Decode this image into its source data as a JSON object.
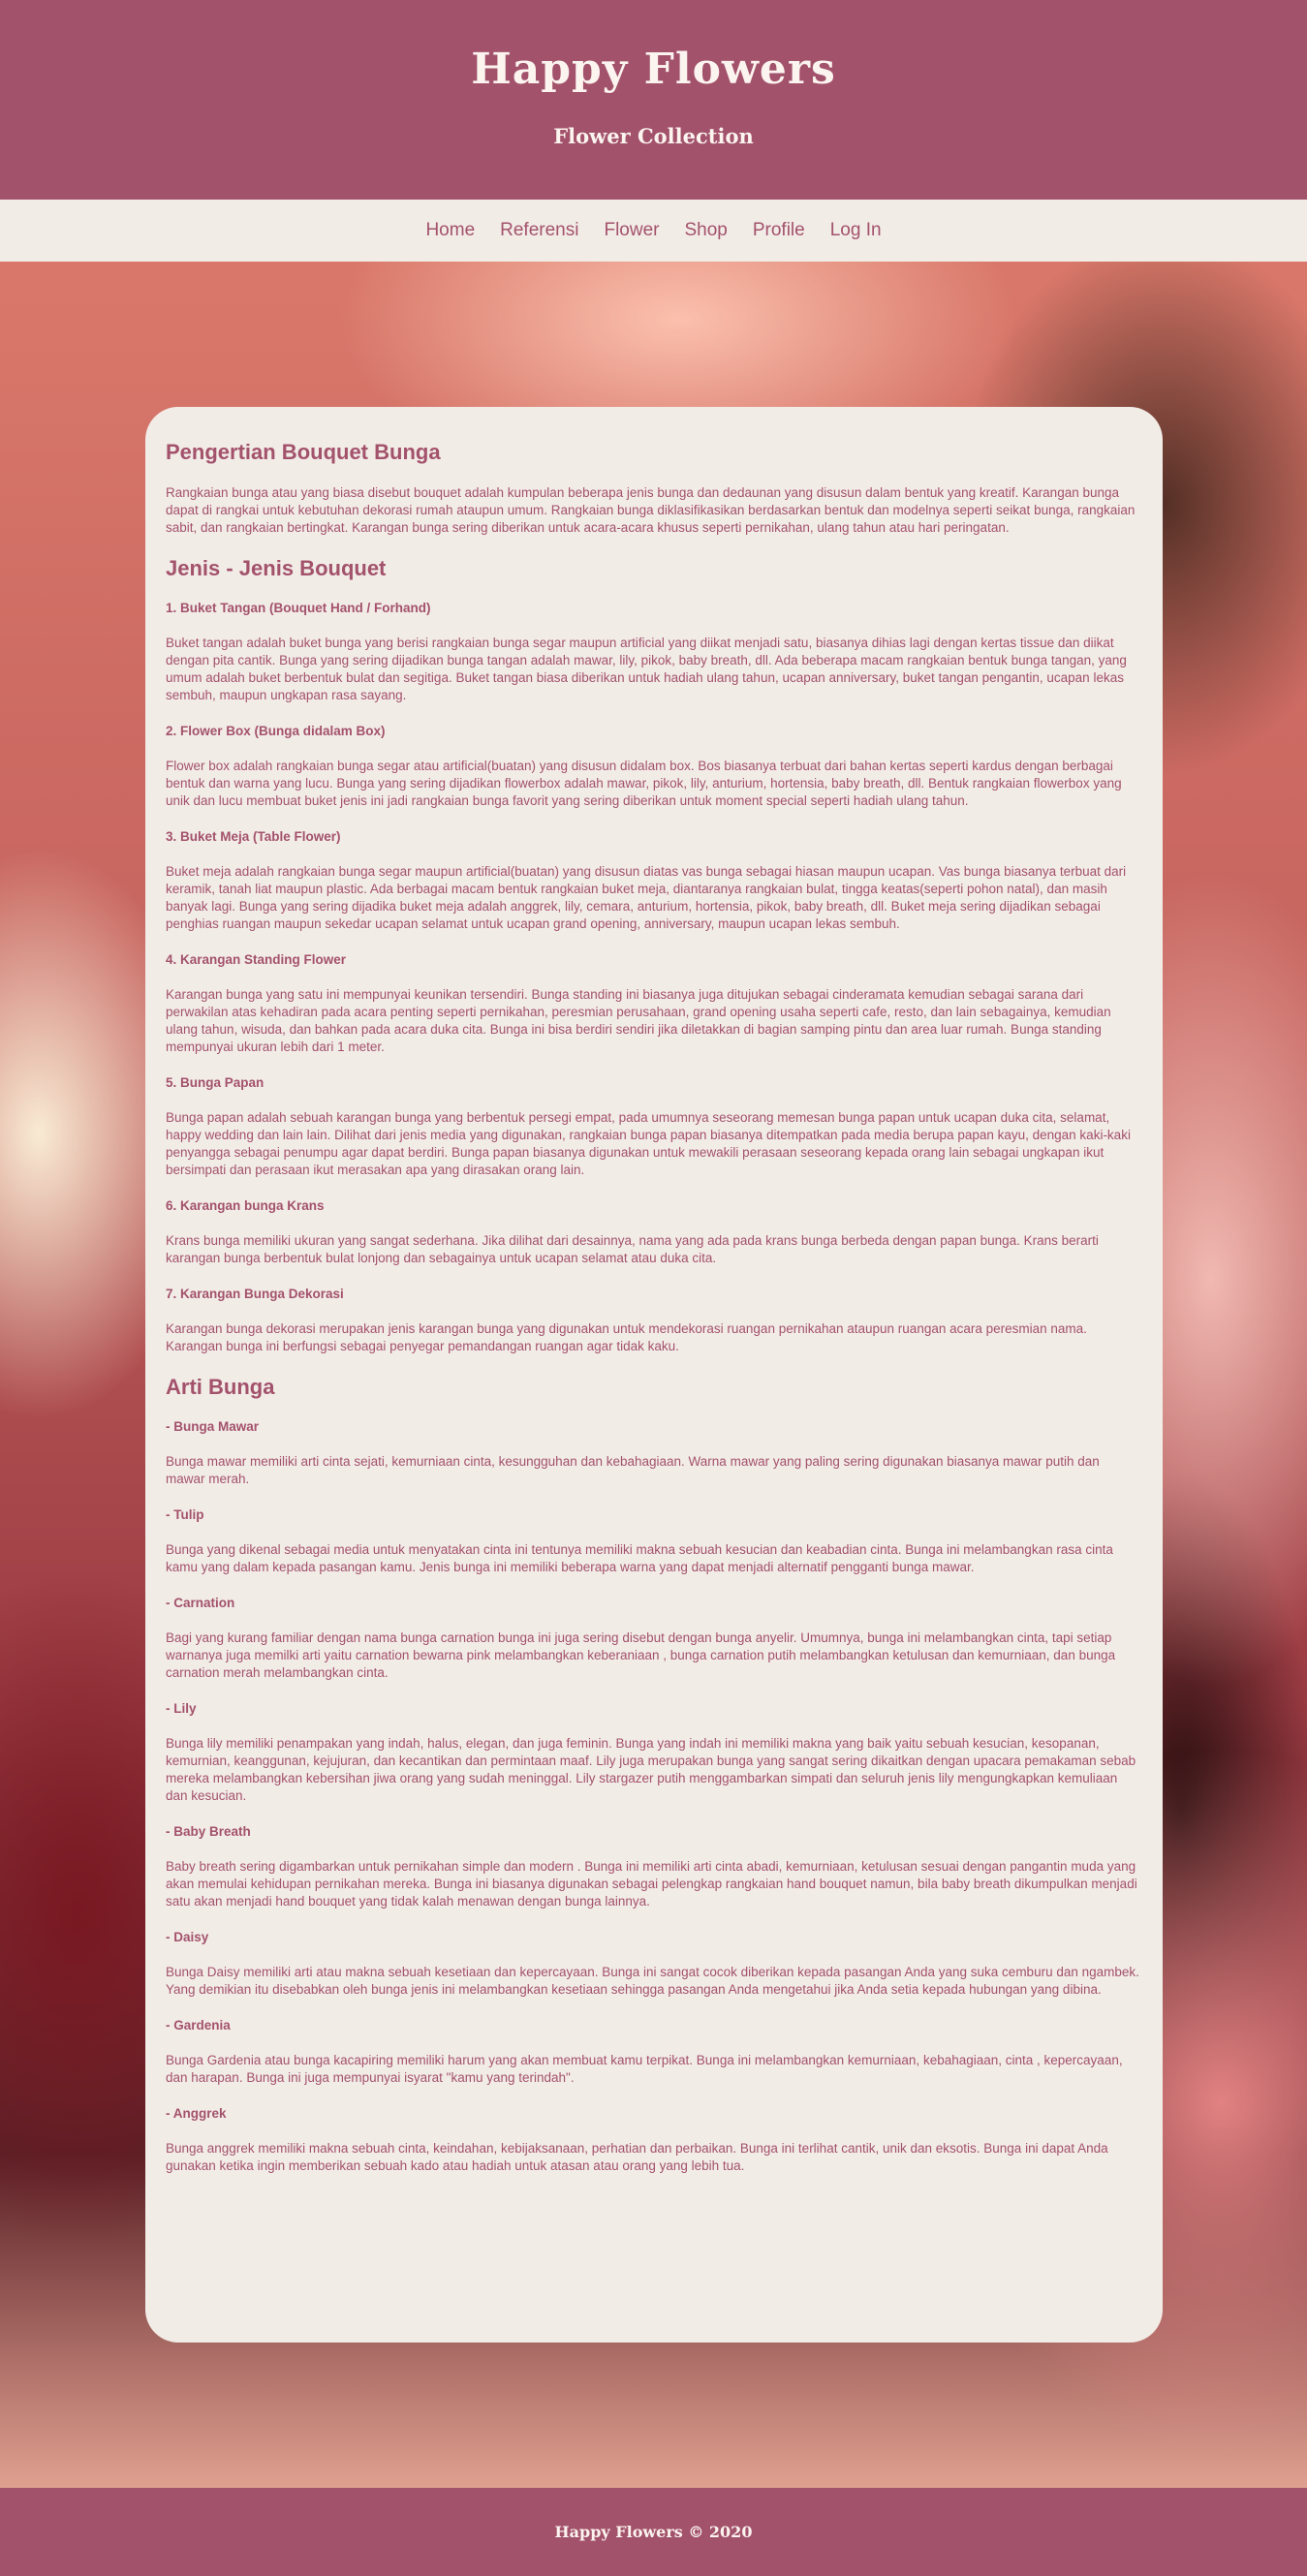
{
  "header": {
    "title": "Happy Flowers",
    "subtitle": "Flower Collection"
  },
  "nav": {
    "items": [
      "Home",
      "Referensi",
      "Flower",
      "Shop",
      "Profile",
      "Log In"
    ]
  },
  "content": {
    "s1_title": "Pengertian Bouquet Bunga",
    "s1_text": "Rangkaian bunga atau yang biasa disebut bouquet adalah kumpulan beberapa jenis bunga dan dedaunan yang disusun dalam bentuk yang kreatif. Karangan bunga dapat di rangkai untuk kebutuhan dekorasi rumah ataupun umum. Rangkaian bunga diklasifikasikan berdasarkan bentuk dan modelnya seperti seikat bunga, rangkaian sabit, dan rangkaian bertingkat. Karangan bunga sering diberikan untuk acara-acara khusus seperti pernikahan, ulang tahun atau hari peringatan.",
    "s2_title": "Jenis - Jenis Bouquet",
    "types": [
      {
        "title": "1. Buket Tangan (Bouquet Hand / Forhand)",
        "text": "Buket tangan adalah buket bunga yang berisi rangkaian bunga segar maupun artificial yang diikat menjadi satu, biasanya dihias lagi dengan kertas tissue dan diikat dengan pita cantik. Bunga yang sering dijadikan bunga tangan adalah mawar, lily, pikok, baby breath, dll. Ada beberapa macam rangkaian bentuk bunga tangan, yang umum adalah buket berbentuk bulat dan segitiga. Buket tangan biasa diberikan untuk hadiah ulang tahun, ucapan anniversary, buket tangan pengantin, ucapan lekas sembuh, maupun ungkapan rasa sayang."
      },
      {
        "title": "2. Flower Box (Bunga didalam Box)",
        "text": "Flower box adalah rangkaian bunga segar atau artificial(buatan) yang disusun didalam box. Bos biasanya terbuat dari bahan kertas seperti kardus dengan berbagai bentuk dan warna yang lucu. Bunga yang sering dijadikan flowerbox adalah mawar, pikok, lily, anturium, hortensia, baby breath, dll. Bentuk rangkaian flowerbox yang unik dan lucu membuat buket jenis ini jadi rangkaian bunga favorit yang sering diberikan untuk moment special seperti hadiah ulang tahun."
      },
      {
        "title": "3. Buket Meja (Table Flower)",
        "text": "Buket meja adalah rangkaian bunga segar maupun artificial(buatan) yang disusun diatas vas bunga sebagai hiasan maupun ucapan. Vas bunga biasanya terbuat dari keramik, tanah liat maupun plastic. Ada berbagai macam bentuk rangkaian buket meja, diantaranya rangkaian bulat, tingga keatas(seperti pohon natal), dan masih banyak lagi. Bunga yang sering dijadika buket meja adalah anggrek, lily, cemara, anturium, hortensia, pikok, baby breath, dll. Buket meja sering dijadikan sebagai penghias ruangan maupun sekedar ucapan selamat untuk ucapan grand opening, anniversary, maupun ucapan lekas sembuh."
      },
      {
        "title": "4. Karangan Standing Flower",
        "text": "Karangan bunga yang satu ini mempunyai keunikan tersendiri. Bunga standing ini biasanya juga ditujukan sebagai cinderamata kemudian sebagai sarana dari perwakilan atas kehadiran pada acara penting seperti pernikahan, peresmian perusahaan, grand opening usaha seperti cafe, resto, dan lain sebagainya, kemudian ulang tahun, wisuda, dan bahkan pada acara duka cita. Bunga ini bisa berdiri sendiri jika diletakkan di bagian samping pintu dan area luar rumah. Bunga standing mempunyai ukuran lebih dari 1 meter."
      },
      {
        "title": "5. Bunga Papan",
        "text": "Bunga papan adalah sebuah karangan bunga yang berbentuk persegi empat, pada umumnya seseorang memesan bunga papan untuk ucapan duka cita, selamat, happy wedding dan lain lain. Dilihat dari jenis media yang digunakan, rangkaian bunga papan biasanya ditempatkan pada media berupa papan kayu, dengan kaki-kaki penyangga sebagai penumpu agar dapat berdiri. Bunga papan biasanya digunakan untuk mewakili perasaan seseorang kepada orang lain sebagai ungkapan ikut bersimpati dan perasaan ikut merasakan apa yang dirasakan orang lain."
      },
      {
        "title": "6. Karangan bunga Krans",
        "text": "Krans bunga memiliki ukuran yang sangat sederhana. Jika dilihat dari desainnya, nama yang ada pada krans bunga berbeda dengan papan bunga. Krans berarti karangan bunga berbentuk bulat lonjong dan sebagainya untuk ucapan selamat atau duka cita."
      },
      {
        "title": "7. Karangan Bunga Dekorasi",
        "text": "Karangan bunga dekorasi merupakan jenis karangan bunga yang digunakan untuk mendekorasi ruangan pernikahan ataupun ruangan acara peresmian nama. Karangan bunga ini berfungsi sebagai penyegar pemandangan ruangan agar tidak kaku."
      }
    ],
    "s3_title": "Arti Bunga",
    "meanings": [
      {
        "title": "- Bunga Mawar",
        "text": "Bunga mawar memiliki arti cinta sejati, kemurniaan cinta, kesungguhan dan kebahagiaan. Warna mawar yang paling sering digunakan biasanya mawar putih dan mawar merah."
      },
      {
        "title": "- Tulip",
        "text": "Bunga yang dikenal sebagai media untuk menyatakan cinta ini tentunya memiliki makna sebuah kesucian dan keabadian cinta. Bunga ini melambangkan rasa cinta kamu yang dalam kepada pasangan kamu. Jenis bunga ini memiliki beberapa warna yang dapat menjadi alternatif pengganti bunga mawar."
      },
      {
        "title": "- Carnation",
        "text": "Bagi yang kurang familiar dengan nama bunga carnation bunga ini juga sering disebut dengan bunga anyelir. Umumnya, bunga ini melambangkan cinta, tapi setiap warnanya juga memilki arti yaitu carnation bewarna pink melambangkan keberaniaan , bunga carnation putih melambangkan ketulusan dan kemurniaan, dan bunga carnation merah melambangkan cinta."
      },
      {
        "title": "- Lily",
        "text": "Bunga lily memiliki penampakan yang indah, halus, elegan, dan juga feminin. Bunga yang indah ini memiliki makna yang baik yaitu sebuah kesucian, kesopanan, kemurnian, keanggunan, kejujuran, dan kecantikan dan permintaan maaf. Lily juga merupakan bunga yang sangat sering dikaitkan dengan upacara pemakaman sebab mereka melambangkan kebersihan jiwa orang yang sudah meninggal. Lily stargazer putih menggambarkan simpati dan seluruh jenis lily mengungkapkan kemuliaan dan kesucian."
      },
      {
        "title": "- Baby Breath",
        "text": "Baby breath sering digambarkan untuk pernikahan simple dan modern . Bunga ini memiliki arti cinta abadi, kemurniaan, ketulusan sesuai dengan pangantin muda yang akan memulai kehidupan pernikahan mereka. Bunga ini biasanya digunakan sebagai pelengkap rangkaian hand bouquet namun, bila baby breath dikumpulkan menjadi satu akan menjadi hand bouquet yang tidak kalah menawan dengan bunga lainnya."
      },
      {
        "title": "- Daisy",
        "text": "Bunga Daisy memiliki arti atau makna sebuah kesetiaan dan kepercayaan. Bunga ini sangat cocok diberikan kepada pasangan Anda yang suka cemburu dan ngambek. Yang demikian itu disebabkan oleh bunga jenis ini melambangkan kesetiaan sehingga pasangan Anda mengetahui jika Anda setia kepada hubungan yang dibina."
      },
      {
        "title": "- Gardenia",
        "text": "Bunga Gardenia atau bunga kacapiring memiliki harum yang akan membuat kamu terpikat. Bunga ini melambangkan kemurniaan, kebahagiaan, cinta , kepercayaan, dan harapan. Bunga ini juga mempunyai isyarat \"kamu yang terindah\"."
      },
      {
        "title": "- Anggrek",
        "text": "Bunga anggrek memiliki makna sebuah cinta, keindahan, kebijaksanaan, perhatian dan perbaikan. Bunga ini terlihat cantik, unik dan eksotis. Bunga ini dapat Anda gunakan ketika ingin memberikan sebuah kado atau hadiah untuk atasan atau orang yang lebih tua."
      }
    ]
  },
  "footer": {
    "text": "Happy Flowers © 2020"
  },
  "colors": {
    "brand": "#a3526c",
    "light": "#f2ece7"
  }
}
